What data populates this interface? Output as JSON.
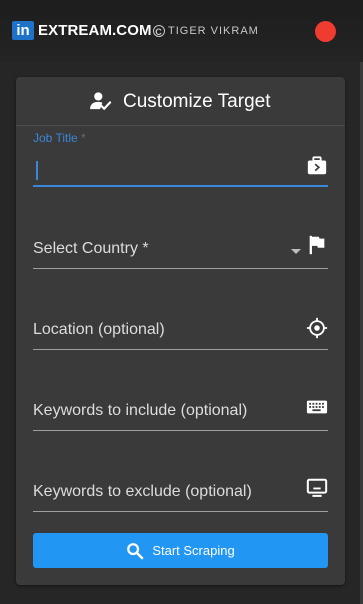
{
  "header": {
    "logo_text": "in",
    "brand": "EXTREAM.COM",
    "sub_brand": "TIGER VIKRAM",
    "copyright_symbol": "C",
    "close_color": "#ef3b30"
  },
  "panel": {
    "title": "Customize Target",
    "title_icon": "person-check-icon"
  },
  "fields": {
    "job_title": {
      "label": "Job Title",
      "required_mark": " *",
      "value": "",
      "icon": "work-icon"
    },
    "country": {
      "placeholder": "Select Country *",
      "icon": "flag-icon"
    },
    "location": {
      "placeholder": "Location (optional)",
      "icon": "gps-icon"
    },
    "include": {
      "placeholder": "Keywords to include (optional)",
      "icon": "keyboard-icon"
    },
    "exclude": {
      "placeholder": "Keywords to exclude (optional)",
      "icon": "monitor-icon"
    }
  },
  "action": {
    "label": "Start Scraping",
    "icon": "search-icon",
    "color": "#2196f3"
  },
  "accent_color": "#3a86d9"
}
